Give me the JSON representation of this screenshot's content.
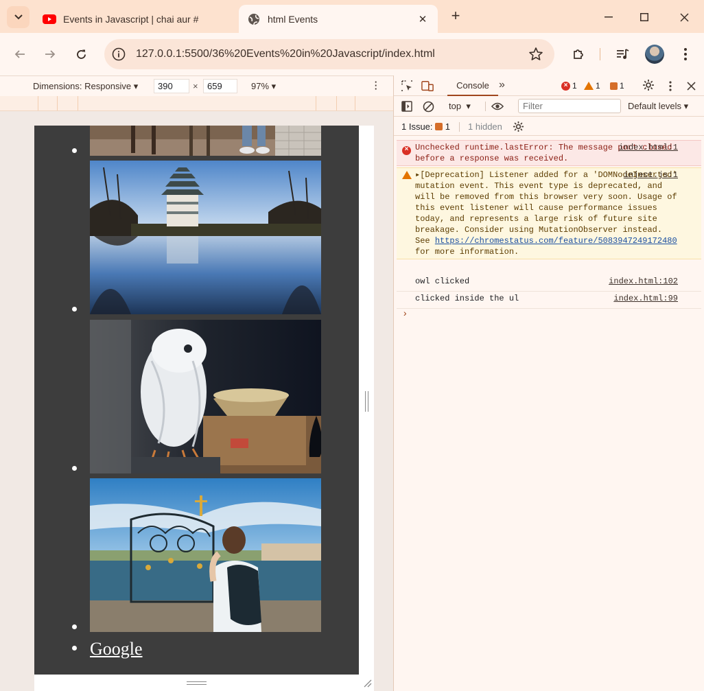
{
  "browser": {
    "tabs": [
      {
        "title": "Events in Javascript | chai aur #",
        "active": false,
        "favicon": "youtube-icon"
      },
      {
        "title": "html Events",
        "active": true,
        "favicon": "globe-icon"
      }
    ],
    "url": "127.0.0.1:5500/36%20Events%20in%20Javascript/index.html"
  },
  "device_toolbar": {
    "dimensions_label": "Dimensions: Responsive",
    "width": "390",
    "height": "659",
    "times": "×",
    "zoom": "97%"
  },
  "page": {
    "images": [
      {
        "name": "walk-photo",
        "desc": "people walking on a path"
      },
      {
        "name": "castle-photo",
        "desc": "japanese castle reflected in water"
      },
      {
        "name": "owl-photo",
        "desc": "white owl figurine"
      },
      {
        "name": "bridge-photo",
        "desc": "woman at ornate bridge railing"
      }
    ],
    "link_text": "Google"
  },
  "devtools": {
    "tab_label": "Console",
    "error_count": "1",
    "warning_count": "1",
    "issue_count": "1",
    "context": "top",
    "filter_placeholder": "Filter",
    "levels": "Default levels",
    "issues_label": "1 Issue:",
    "issues_num": "1",
    "hidden": "1 hidden",
    "messages": [
      {
        "type": "error",
        "text": "Unchecked runtime.lastError: The message port closed before a response was received.",
        "source": "index.html:1"
      },
      {
        "type": "warning",
        "text_before": "[Deprecation] Listener added for a 'DOMNodeInserted' mutation event. This event type is deprecated, and will be removed from this browser very soon. Usage of this event listener will cause performance issues today, and represents a large risk of future site breakage. Consider using MutationObserver instead. See ",
        "link": "https://chromestatus.com/feature/5083947249172480",
        "text_after": " for more information.",
        "source": "inject.js:1"
      },
      {
        "type": "log",
        "text": "owl clicked",
        "source": "index.html:102"
      },
      {
        "type": "log",
        "text": "clicked inside the ul",
        "source": "index.html:99"
      }
    ],
    "prompt": "›"
  },
  "colors": {
    "accent": "#a0461d",
    "error": "#d93025",
    "warning": "#e37400",
    "page_bg": "#3d3d3d"
  }
}
